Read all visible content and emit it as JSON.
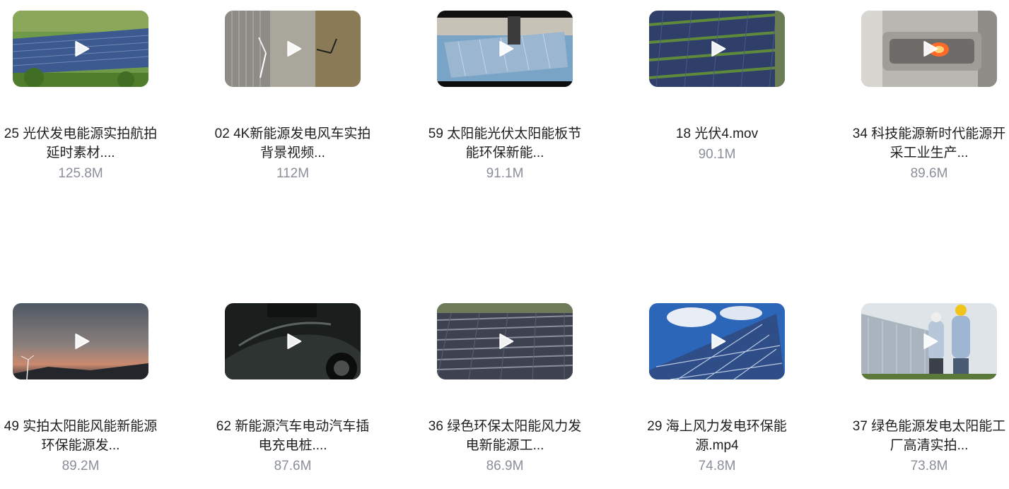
{
  "files": [
    {
      "title": "25 光伏发电能源实拍航拍延时素材....",
      "size": "125.8M",
      "thumb": "solar-hillside"
    },
    {
      "title": "02 4K新能源发电风车实拍背景视频...",
      "size": "112M",
      "thumb": "wind-turbine-fields"
    },
    {
      "title": "59 太阳能光伏太阳能板节能环保新能...",
      "size": "91.1M",
      "thumb": "panel-manufacturing"
    },
    {
      "title": "18 光伏4.mov",
      "size": "90.1M",
      "thumb": "solar-farm-aerial"
    },
    {
      "title": "34 科技能源新时代能源开采工业生产...",
      "size": "89.6M",
      "thumb": "industrial-furnace"
    },
    {
      "title": "49 实拍太阳能风能新能源环保能源发...",
      "size": "89.2M",
      "thumb": "sunset-wind"
    },
    {
      "title": "62 新能源汽车电动汽车插电充电桩....",
      "size": "87.6M",
      "thumb": "electric-car"
    },
    {
      "title": "36 绿色环保太阳能风力发电新能源工...",
      "size": "86.9M",
      "thumb": "solar-rows"
    },
    {
      "title": "29 海上风力发电环保能源.mp4",
      "size": "74.8M",
      "thumb": "solar-sky"
    },
    {
      "title": "37 绿色能源发电太阳能工厂高清实拍...",
      "size": "73.8M",
      "thumb": "engineers-panels"
    }
  ]
}
